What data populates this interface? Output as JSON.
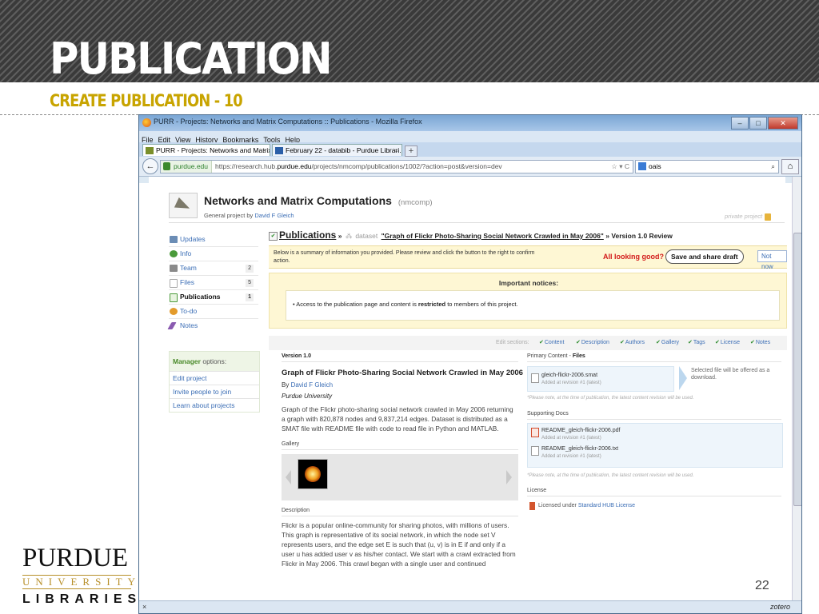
{
  "slide": {
    "title": "PUBLICATION",
    "subtitle": "CREATE PUBLICATION - 10",
    "number": "22",
    "logo": {
      "line1": "PURDUE",
      "line2": "UNIVERSITY",
      "line3": "LIBRARIES"
    }
  },
  "browser": {
    "window_title": "PURR - Projects: Networks and Matrix Computations :: Publications - Mozilla Firefox",
    "menu": [
      "File",
      "Edit",
      "View",
      "History",
      "Bookmarks",
      "Tools",
      "Help"
    ],
    "tabs": [
      {
        "label": "PURR - Projects: Networks and Matrix..."
      },
      {
        "label": "February 22 - databib - Purdue Librari..."
      }
    ],
    "url_site": "purdue.edu",
    "url_prefix": "https://research.hub.",
    "url_domain": "purdue.edu",
    "url_path": "/projects/nmcomp/publications/1002/?action=post&version=dev",
    "search_value": "oais",
    "status_close": "×",
    "status_right": "zotero"
  },
  "project": {
    "title": "Networks and Matrix Computations",
    "alias": "(nmcomp)",
    "subtitle_prefix": "General project by",
    "owner": "David F Gleich",
    "privacy": "private project"
  },
  "sidebar": {
    "items": [
      {
        "label": "Updates",
        "count": "",
        "color": "#6b8db5"
      },
      {
        "label": "Info",
        "count": "",
        "color": "#4a9a3a"
      },
      {
        "label": "Team",
        "count": "2",
        "color": "#8a8a8a"
      },
      {
        "label": "Files",
        "count": "5",
        "color": "#bfbfbf"
      },
      {
        "label": "Publications",
        "count": "1",
        "color": "#4a9a3a"
      },
      {
        "label": "To-do",
        "count": "",
        "color": "#e39b2c"
      },
      {
        "label": "Notes",
        "count": "",
        "color": "#8a5ab0"
      }
    ],
    "manager_title_bold": "Manager",
    "manager_title_rest": "options:",
    "manager_links": [
      "Edit project",
      "Invite people to join",
      "Learn about projects"
    ]
  },
  "review": {
    "crumb_main": "Publications",
    "crumb_sep": "»",
    "crumb_type": "dataset",
    "crumb_title": "\"Graph of Flickr Photo-Sharing Social Network Crawled in May 2006\"",
    "crumb_sep2": "»",
    "crumb_version": "Version 1.0 Review",
    "summary": "Below is a summary of information you provided. Please review and click the button to the right to confirm action.",
    "looking_good": "All looking good?",
    "save_button": "Save and share draft",
    "not_now": "Not now",
    "notices_title": "Important notices:",
    "notice_pre": "Access to the publication page and content is",
    "notice_bold": "restricted",
    "notice_post": "to members of this project.",
    "edit_sections_label": "Edit sections:",
    "edit_sections": [
      "Content",
      "Description",
      "Authors",
      "Gallery",
      "Tags",
      "License",
      "Notes"
    ]
  },
  "publication": {
    "version": "Version 1.0",
    "title": "Graph of Flickr Photo-Sharing Social Network Crawled in May 2006",
    "by": "By",
    "author": "David F Gleich",
    "affiliation": "Purdue University",
    "abstract": "Graph of the Flickr photo-sharing social network crawled in May 2006 returning a graph with 820,878 nodes and 9,837,214 edges. Dataset is distributed as a SMAT file with README file with code to read file in Python and MATLAB.",
    "gallery_label": "Gallery",
    "description_label": "Description",
    "description": "Flickr is a popular online-community for sharing photos, with millions of users. This graph is representative of its social network, in which the node set V represents users, and the edge set E is such that (u, v) is in E if and only if a user u has added user v as his/her contact. We start with a crawl extracted from Flickr in May 2006. This crawl began with a single user and continued"
  },
  "files": {
    "primary_label": "Primary Content -",
    "primary_label_bold": "Files",
    "primary_file": "gleich-flickr-2006.smat",
    "primary_meta": "Added at revision #1 (latest)",
    "download_note": "Selected file will be offered as a download.",
    "revision_note": "*Please note, at the time of publication, the latest content revision will be used.",
    "supporting_label": "Supporting Docs",
    "docs": [
      {
        "name": "README_gleich-flickr-2006.pdf",
        "meta": "Added at revision #1 (latest)"
      },
      {
        "name": "README_gleich-flickr-2006.txt",
        "meta": "Added at revision #1 (latest)"
      }
    ],
    "revision_note2": "*Please note, at the time of publication, the latest content revision will be used.",
    "license_label": "License",
    "license_prefix": "Licensed under",
    "license_name": "Standard HUB License"
  }
}
